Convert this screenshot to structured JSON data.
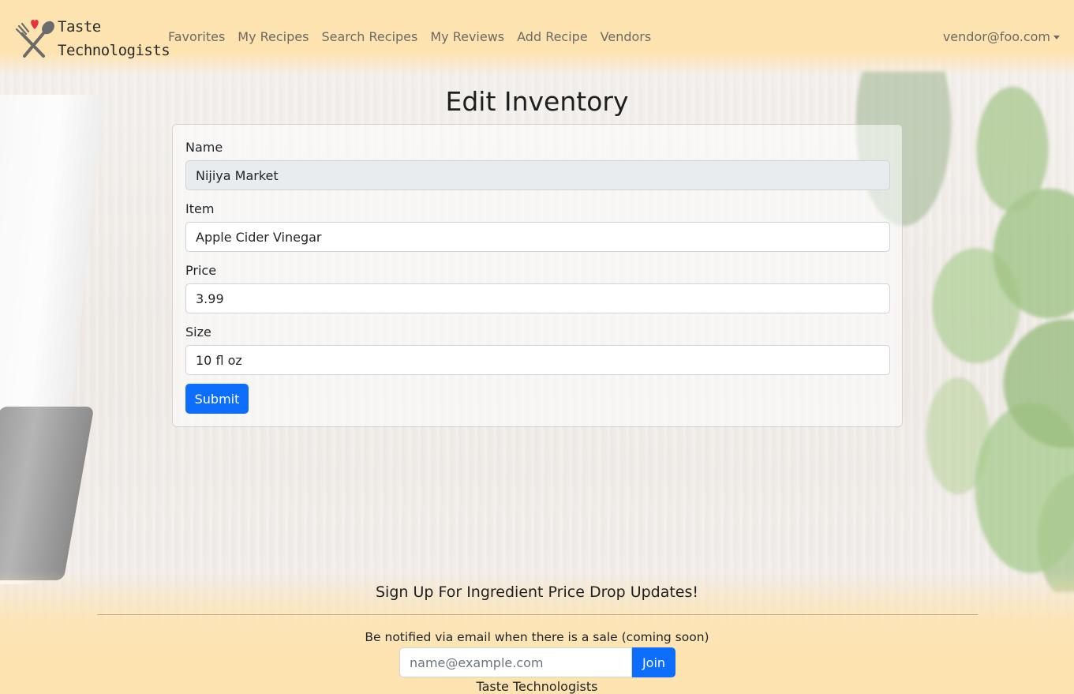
{
  "navbar": {
    "brand_line1": "Taste",
    "brand_line2": "Technologists",
    "links": [
      "Favorites",
      "My Recipes",
      "Search Recipes",
      "My Reviews",
      "Add Recipe",
      "Vendors"
    ],
    "user": "vendor@foo.com"
  },
  "page": {
    "title": "Edit Inventory"
  },
  "form": {
    "name_label": "Name",
    "name_value": "Nijiya Market",
    "item_label": "Item",
    "item_value": "Apple Cider Vinegar",
    "price_label": "Price",
    "price_value": "3.99",
    "size_label": "Size",
    "size_value": "10 fl oz",
    "submit_label": "Submit"
  },
  "footer": {
    "title": "Sign Up For Ingredient Price Drop Updates!",
    "subtitle": "Be notified via email when there is a sale (coming soon)",
    "email_placeholder": "name@example.com",
    "join_label": "Join",
    "brand": "Taste Technologists"
  },
  "colors": {
    "navbar_bg": "#fde3b0",
    "primary": "#0d6efd",
    "logo_heart": "#e5323c"
  },
  "icons": {
    "logo": "fork-spoon-heart-icon",
    "user_menu_caret": "caret-down-icon"
  }
}
